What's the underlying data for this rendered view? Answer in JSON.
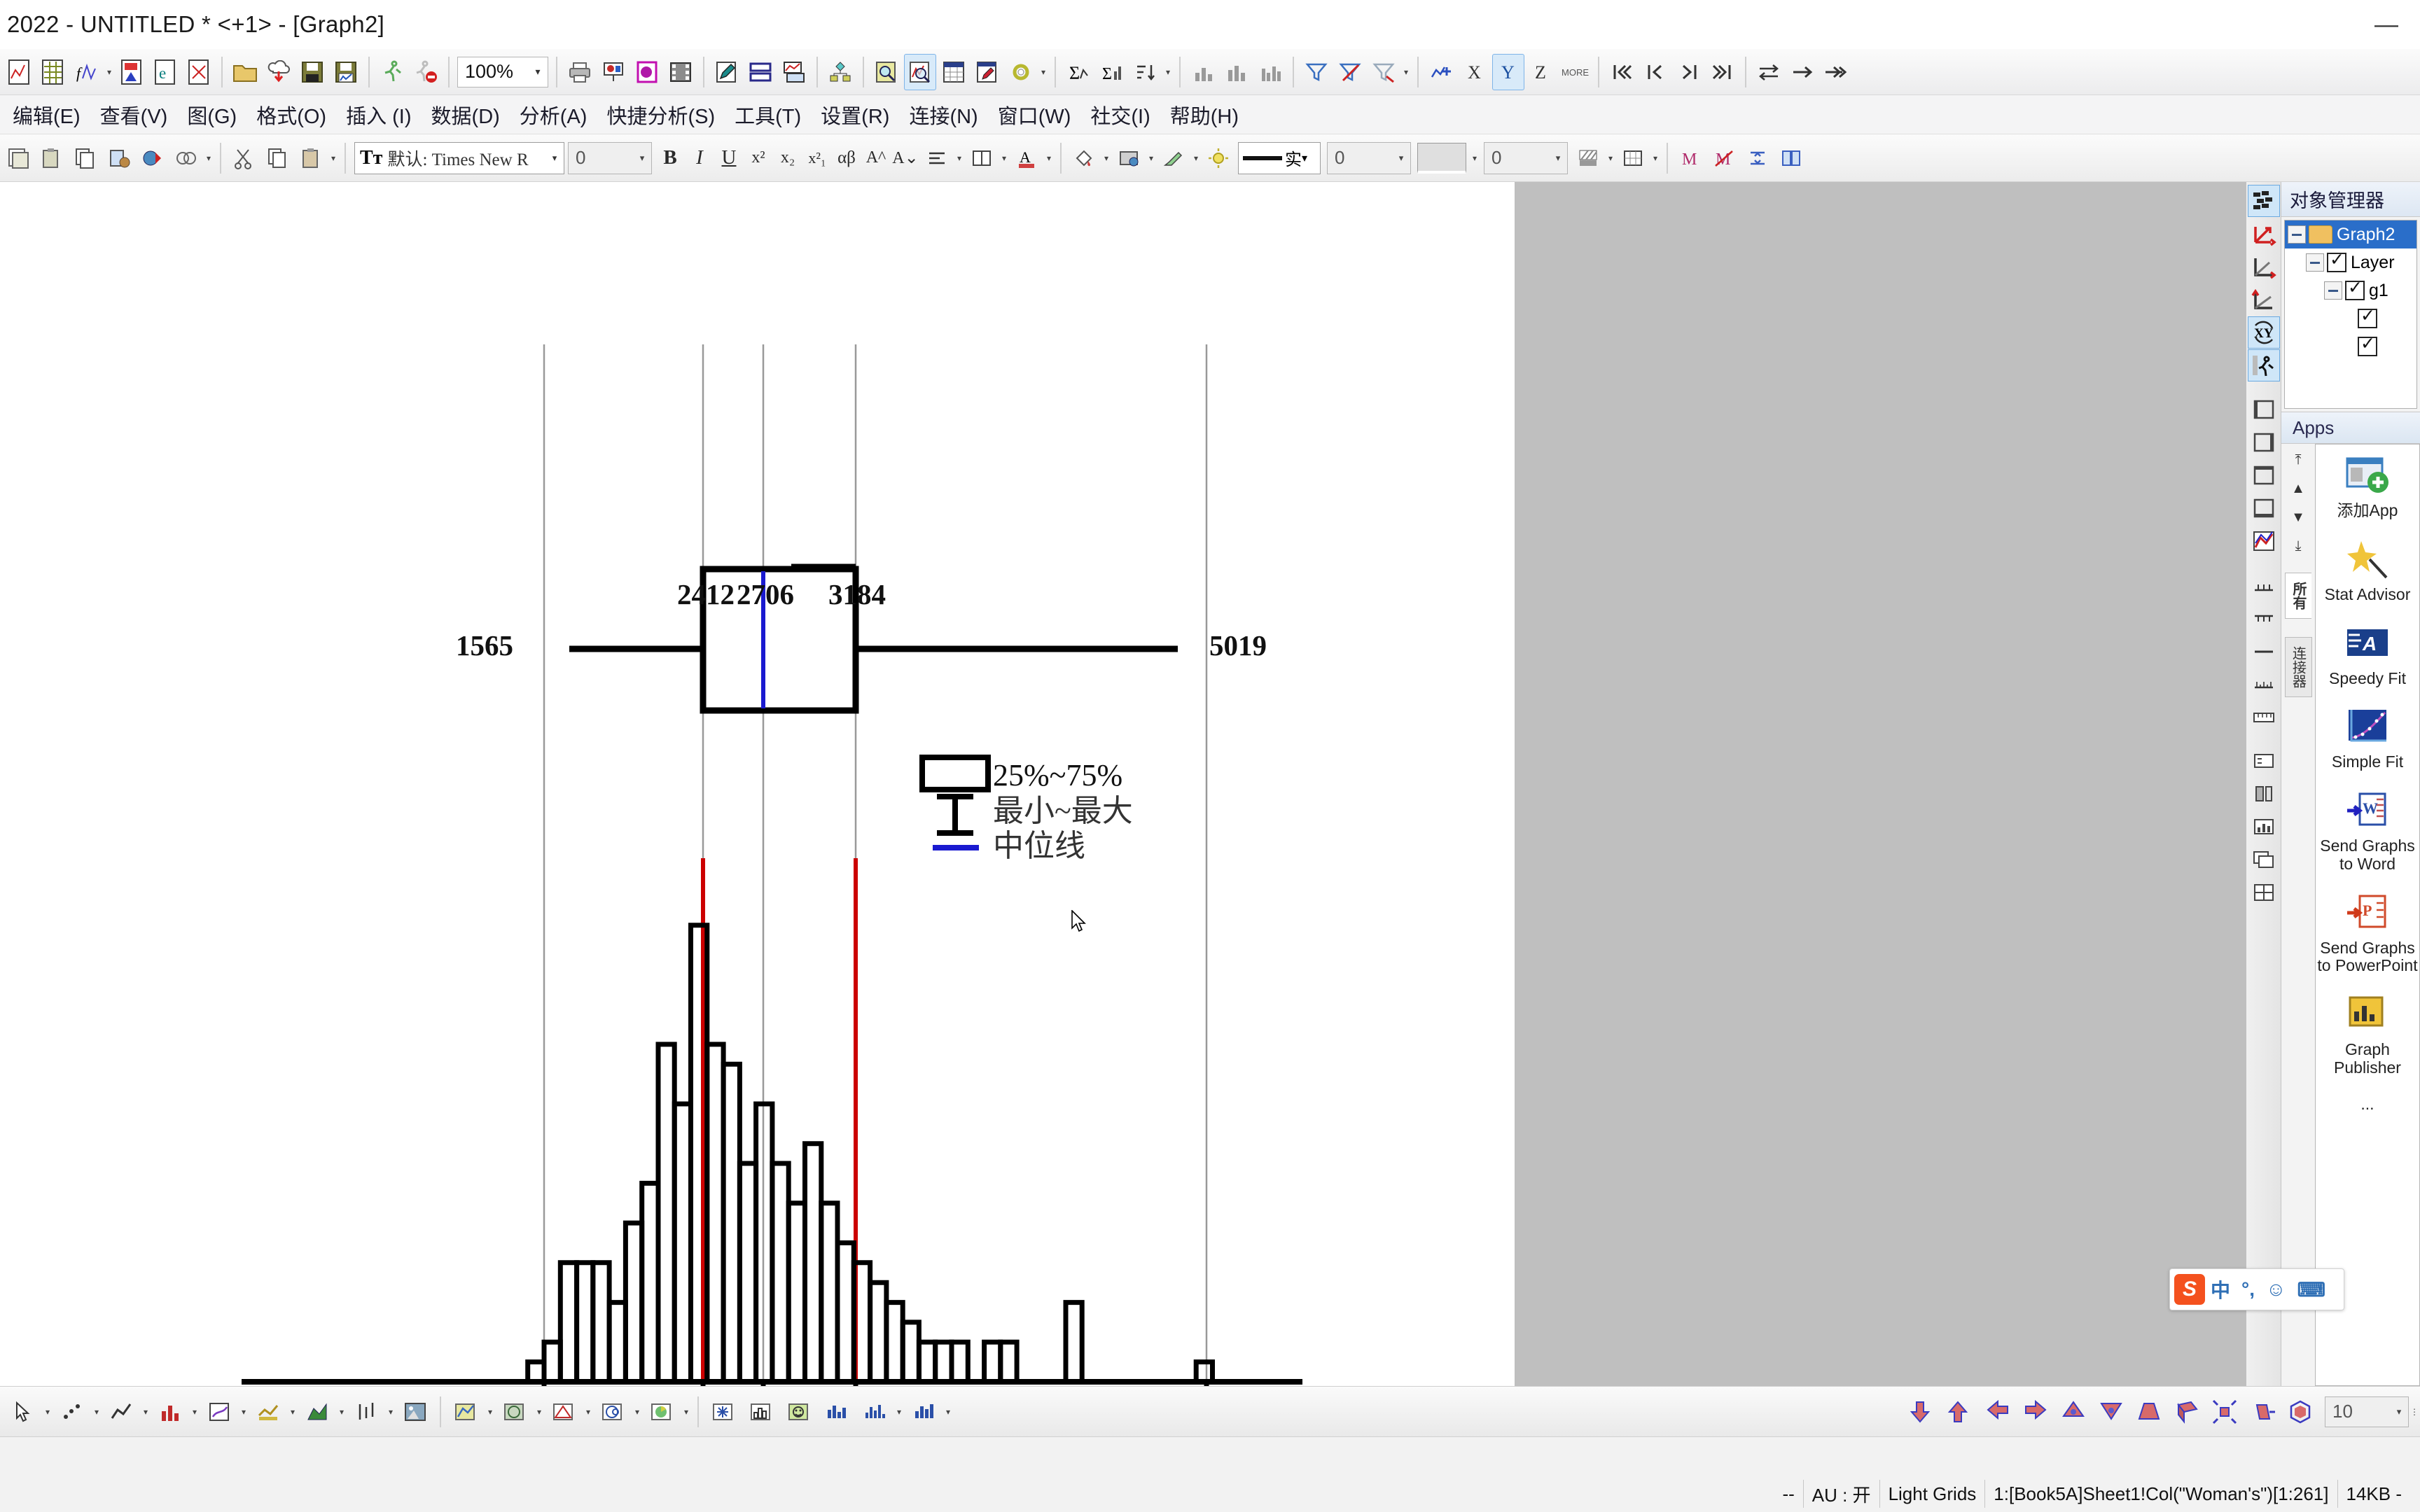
{
  "window": {
    "title": " 2022 - UNTITLED * <+1> - [Graph2]",
    "minimize_label": "—"
  },
  "menu": {
    "items": [
      {
        "label": "编辑(E)"
      },
      {
        "label": "查看(V)"
      },
      {
        "label": "图(G)"
      },
      {
        "label": "格式(O)"
      },
      {
        "label": "插入 (I)"
      },
      {
        "label": "数据(D)"
      },
      {
        "label": "分析(A)"
      },
      {
        "label": "快捷分析(S)"
      },
      {
        "label": "工具(T)"
      },
      {
        "label": "设置(R)"
      },
      {
        "label": "连接(N)"
      },
      {
        "label": "窗口(W)"
      },
      {
        "label": "社交(I)"
      },
      {
        "label": "帮助(H)"
      }
    ]
  },
  "toolbar": {
    "zoom_value": "100%",
    "zoom_caret": "▾"
  },
  "format_toolbar": {
    "font_value": "默认: Times New R",
    "font_icon": "Tт",
    "font_size_value": "0",
    "bold": "B",
    "italic": "I",
    "underline": "U",
    "superscript": "x²",
    "subscript": "x₂",
    "supsub": "x²₁",
    "greek": "αβ",
    "increase_font": "A^",
    "decrease_font": "A⌄",
    "line_style_value": "实",
    "line_width_value": "0",
    "fill_value": "0",
    "caret": "▾"
  },
  "object_manager": {
    "title": "对象管理器",
    "tree": [
      {
        "label": "Graph2",
        "type": "folder",
        "selected": true,
        "indent": 0,
        "expander": true,
        "checkbox": false
      },
      {
        "label": "Layer",
        "type": "layer",
        "selected": false,
        "indent": 1,
        "expander": true,
        "checkbox": true
      },
      {
        "label": "g1",
        "type": "group",
        "selected": false,
        "indent": 2,
        "expander": true,
        "checkbox": true
      },
      {
        "label": "",
        "type": "plot",
        "selected": false,
        "indent": 3,
        "expander": false,
        "checkbox": true
      },
      {
        "label": "",
        "type": "plot",
        "selected": false,
        "indent": 3,
        "expander": false,
        "checkbox": true
      }
    ]
  },
  "apps_panel": {
    "title": "Apps",
    "nav": [
      "⤒",
      "▲",
      "▼",
      "⤓"
    ],
    "tabs": [
      {
        "label": "所有",
        "active": true
      },
      {
        "label": "连接器",
        "active": false
      }
    ],
    "items": [
      {
        "name": "添加App",
        "icon": "add-app-icon"
      },
      {
        "name": "Stat Advisor",
        "icon": "star-wand-icon"
      },
      {
        "name": "Speedy Fit",
        "icon": "speedy-fit-icon"
      },
      {
        "name": "Simple Fit",
        "icon": "simple-fit-icon"
      },
      {
        "name": "Send Graphs to Word",
        "icon": "word-icon"
      },
      {
        "name": "Send Graphs to PowerPoint",
        "icon": "powerpoint-icon"
      },
      {
        "name": "Graph Publisher",
        "icon": "graph-publisher-icon"
      },
      {
        "name": "...",
        "icon": "more-icon"
      }
    ]
  },
  "bottom_toolbar": {
    "value": "10",
    "caret": "▾"
  },
  "status_bar": {
    "cells": [
      "--",
      "AU : 开",
      "Light Grids",
      "1:[Book5A]Sheet1!Col(\"Woman's\")[1:261]",
      "14KB -"
    ]
  },
  "ime": {
    "logo": "S",
    "items": [
      "中",
      "°,",
      "☺",
      "⌨"
    ]
  },
  "graph": {
    "legend": {
      "box_label": "25%~75%",
      "whisker_label": "最小~最大",
      "median_label": "中位线"
    },
    "box_labels": {
      "min": "1565",
      "q1": "2412",
      "median": "2706",
      "q3": "3184",
      "max": "5019"
    },
    "axis_labels": [
      "1565",
      "2412",
      "2706",
      "3184",
      "5019"
    ],
    "colors": {
      "median_line": "#1a1ad0",
      "reference_line": "#cc0000",
      "grid_line": "#999999",
      "plot_line": "#000000"
    }
  },
  "chart_data": {
    "type": "histogram",
    "title": "",
    "xlabel": "",
    "ylabel": "",
    "xlim": [
      1300,
      5250
    ],
    "grid": true,
    "legend_position": "inside-center",
    "tick_labels": [
      "1565",
      "2412",
      "2706",
      "3184",
      "5019"
    ],
    "tick_values": [
      1565,
      2412,
      2706,
      3184,
      5019
    ],
    "boxplot": {
      "min": 1565,
      "q1": 2412,
      "median": 2706,
      "q3": 3184,
      "max": 5019,
      "labels": [
        "1565",
        "2412",
        "2706",
        "3184",
        "5019"
      ]
    },
    "reference_lines": [
      {
        "x": 2412,
        "color": "#cc0000"
      },
      {
        "x": 3184,
        "color": "#cc0000"
      }
    ],
    "bin_width": 85,
    "bins": [
      {
        "x": 1480,
        "count": 1
      },
      {
        "x": 1565,
        "count": 2
      },
      {
        "x": 1650,
        "count": 6
      },
      {
        "x": 1735,
        "count": 6
      },
      {
        "x": 1820,
        "count": 6
      },
      {
        "x": 1905,
        "count": 4
      },
      {
        "x": 1990,
        "count": 8
      },
      {
        "x": 2075,
        "count": 10
      },
      {
        "x": 2160,
        "count": 17
      },
      {
        "x": 2245,
        "count": 14
      },
      {
        "x": 2330,
        "count": 23
      },
      {
        "x": 2415,
        "count": 17
      },
      {
        "x": 2500,
        "count": 16
      },
      {
        "x": 2585,
        "count": 11
      },
      {
        "x": 2670,
        "count": 14
      },
      {
        "x": 2755,
        "count": 11
      },
      {
        "x": 2840,
        "count": 9
      },
      {
        "x": 2925,
        "count": 12
      },
      {
        "x": 3010,
        "count": 9
      },
      {
        "x": 3095,
        "count": 7
      },
      {
        "x": 3180,
        "count": 6
      },
      {
        "x": 3265,
        "count": 5
      },
      {
        "x": 3350,
        "count": 4
      },
      {
        "x": 3435,
        "count": 3
      },
      {
        "x": 3520,
        "count": 2
      },
      {
        "x": 3605,
        "count": 2
      },
      {
        "x": 3690,
        "count": 2
      },
      {
        "x": 3775,
        "count": 0
      },
      {
        "x": 3860,
        "count": 2
      },
      {
        "x": 3945,
        "count": 2
      },
      {
        "x": 4030,
        "count": 0
      },
      {
        "x": 4115,
        "count": 0
      },
      {
        "x": 4200,
        "count": 0
      },
      {
        "x": 4285,
        "count": 4
      },
      {
        "x": 4370,
        "count": 0
      },
      {
        "x": 4455,
        "count": 0
      },
      {
        "x": 4540,
        "count": 0
      },
      {
        "x": 4625,
        "count": 0
      },
      {
        "x": 4710,
        "count": 0
      },
      {
        "x": 4795,
        "count": 0
      },
      {
        "x": 4880,
        "count": 0
      },
      {
        "x": 4965,
        "count": 1
      }
    ],
    "ymax": 25
  }
}
